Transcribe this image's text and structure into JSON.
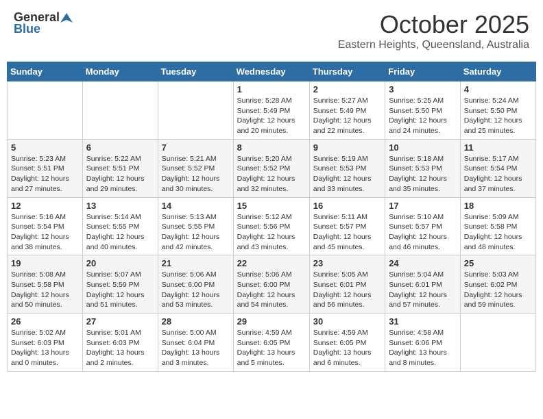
{
  "header": {
    "logo_general": "General",
    "logo_blue": "Blue",
    "month": "October 2025",
    "location": "Eastern Heights, Queensland, Australia"
  },
  "weekdays": [
    "Sunday",
    "Monday",
    "Tuesday",
    "Wednesday",
    "Thursday",
    "Friday",
    "Saturday"
  ],
  "weeks": [
    [
      {
        "day": "",
        "info": ""
      },
      {
        "day": "",
        "info": ""
      },
      {
        "day": "",
        "info": ""
      },
      {
        "day": "1",
        "info": "Sunrise: 5:28 AM\nSunset: 5:49 PM\nDaylight: 12 hours\nand 20 minutes."
      },
      {
        "day": "2",
        "info": "Sunrise: 5:27 AM\nSunset: 5:49 PM\nDaylight: 12 hours\nand 22 minutes."
      },
      {
        "day": "3",
        "info": "Sunrise: 5:25 AM\nSunset: 5:50 PM\nDaylight: 12 hours\nand 24 minutes."
      },
      {
        "day": "4",
        "info": "Sunrise: 5:24 AM\nSunset: 5:50 PM\nDaylight: 12 hours\nand 25 minutes."
      }
    ],
    [
      {
        "day": "5",
        "info": "Sunrise: 5:23 AM\nSunset: 5:51 PM\nDaylight: 12 hours\nand 27 minutes."
      },
      {
        "day": "6",
        "info": "Sunrise: 5:22 AM\nSunset: 5:51 PM\nDaylight: 12 hours\nand 29 minutes."
      },
      {
        "day": "7",
        "info": "Sunrise: 5:21 AM\nSunset: 5:52 PM\nDaylight: 12 hours\nand 30 minutes."
      },
      {
        "day": "8",
        "info": "Sunrise: 5:20 AM\nSunset: 5:52 PM\nDaylight: 12 hours\nand 32 minutes."
      },
      {
        "day": "9",
        "info": "Sunrise: 5:19 AM\nSunset: 5:53 PM\nDaylight: 12 hours\nand 33 minutes."
      },
      {
        "day": "10",
        "info": "Sunrise: 5:18 AM\nSunset: 5:53 PM\nDaylight: 12 hours\nand 35 minutes."
      },
      {
        "day": "11",
        "info": "Sunrise: 5:17 AM\nSunset: 5:54 PM\nDaylight: 12 hours\nand 37 minutes."
      }
    ],
    [
      {
        "day": "12",
        "info": "Sunrise: 5:16 AM\nSunset: 5:54 PM\nDaylight: 12 hours\nand 38 minutes."
      },
      {
        "day": "13",
        "info": "Sunrise: 5:14 AM\nSunset: 5:55 PM\nDaylight: 12 hours\nand 40 minutes."
      },
      {
        "day": "14",
        "info": "Sunrise: 5:13 AM\nSunset: 5:55 PM\nDaylight: 12 hours\nand 42 minutes."
      },
      {
        "day": "15",
        "info": "Sunrise: 5:12 AM\nSunset: 5:56 PM\nDaylight: 12 hours\nand 43 minutes."
      },
      {
        "day": "16",
        "info": "Sunrise: 5:11 AM\nSunset: 5:57 PM\nDaylight: 12 hours\nand 45 minutes."
      },
      {
        "day": "17",
        "info": "Sunrise: 5:10 AM\nSunset: 5:57 PM\nDaylight: 12 hours\nand 46 minutes."
      },
      {
        "day": "18",
        "info": "Sunrise: 5:09 AM\nSunset: 5:58 PM\nDaylight: 12 hours\nand 48 minutes."
      }
    ],
    [
      {
        "day": "19",
        "info": "Sunrise: 5:08 AM\nSunset: 5:58 PM\nDaylight: 12 hours\nand 50 minutes."
      },
      {
        "day": "20",
        "info": "Sunrise: 5:07 AM\nSunset: 5:59 PM\nDaylight: 12 hours\nand 51 minutes."
      },
      {
        "day": "21",
        "info": "Sunrise: 5:06 AM\nSunset: 6:00 PM\nDaylight: 12 hours\nand 53 minutes."
      },
      {
        "day": "22",
        "info": "Sunrise: 5:06 AM\nSunset: 6:00 PM\nDaylight: 12 hours\nand 54 minutes."
      },
      {
        "day": "23",
        "info": "Sunrise: 5:05 AM\nSunset: 6:01 PM\nDaylight: 12 hours\nand 56 minutes."
      },
      {
        "day": "24",
        "info": "Sunrise: 5:04 AM\nSunset: 6:01 PM\nDaylight: 12 hours\nand 57 minutes."
      },
      {
        "day": "25",
        "info": "Sunrise: 5:03 AM\nSunset: 6:02 PM\nDaylight: 12 hours\nand 59 minutes."
      }
    ],
    [
      {
        "day": "26",
        "info": "Sunrise: 5:02 AM\nSunset: 6:03 PM\nDaylight: 13 hours\nand 0 minutes."
      },
      {
        "day": "27",
        "info": "Sunrise: 5:01 AM\nSunset: 6:03 PM\nDaylight: 13 hours\nand 2 minutes."
      },
      {
        "day": "28",
        "info": "Sunrise: 5:00 AM\nSunset: 6:04 PM\nDaylight: 13 hours\nand 3 minutes."
      },
      {
        "day": "29",
        "info": "Sunrise: 4:59 AM\nSunset: 6:05 PM\nDaylight: 13 hours\nand 5 minutes."
      },
      {
        "day": "30",
        "info": "Sunrise: 4:59 AM\nSunset: 6:05 PM\nDaylight: 13 hours\nand 6 minutes."
      },
      {
        "day": "31",
        "info": "Sunrise: 4:58 AM\nSunset: 6:06 PM\nDaylight: 13 hours\nand 8 minutes."
      },
      {
        "day": "",
        "info": ""
      }
    ]
  ]
}
